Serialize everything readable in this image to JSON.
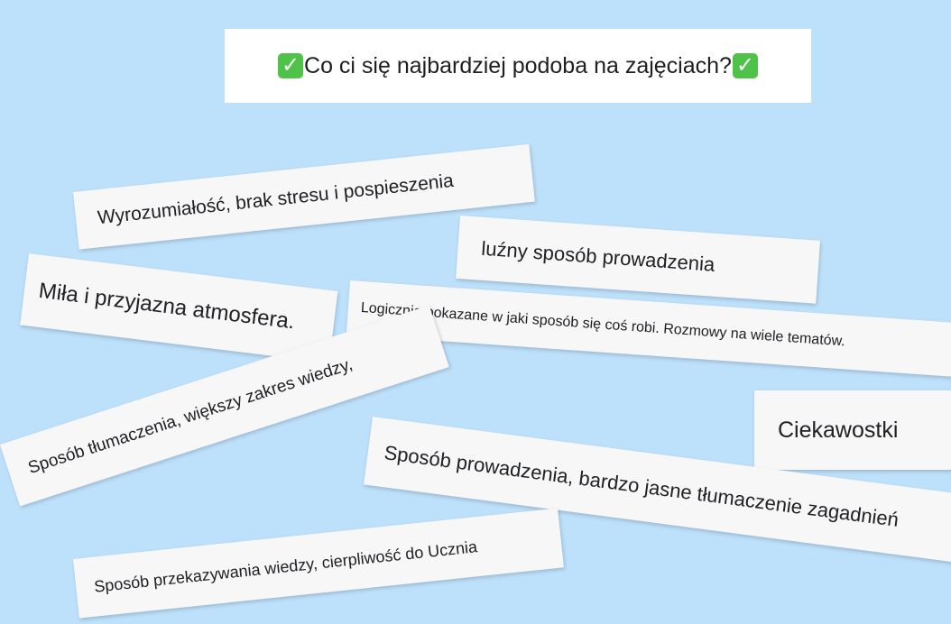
{
  "title": {
    "text": "Co ci się najbardziej podoba na zajęciach?",
    "leading_icon": "check-mark-button-icon",
    "trailing_icon": "check-mark-button-icon",
    "icon_glyph": "✓"
  },
  "colors": {
    "background": "#bde0fb",
    "card": "#f7f7f8",
    "check_icon": "#4fc24a"
  },
  "responses": [
    "Wyrozumiałość, brak stresu i pospieszenia",
    "luźny sposób prowadzenia",
    "Miła i przyjazna atmosfera.",
    "Logicznie pokazane w jaki sposób się coś robi. Rozmowy na wiele tematów.",
    "Sposób tłumaczenia, większy zakres wiedzy,",
    "Ciekawostki",
    "Sposób prowadzenia, bardzo jasne tłumaczenie zagadnień",
    "Sposób przekazywania wiedzy, cierpliwość do Ucznia"
  ]
}
